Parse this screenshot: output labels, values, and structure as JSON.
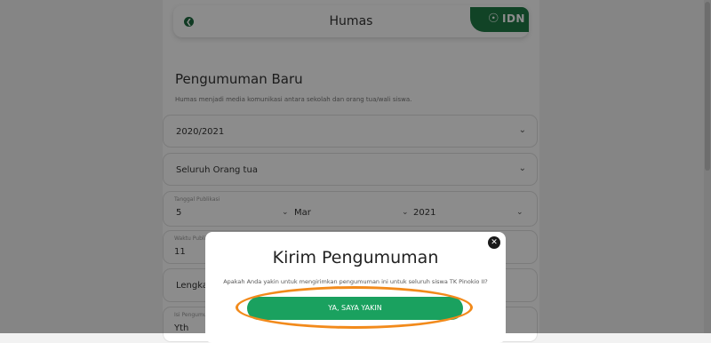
{
  "header": {
    "title": "Humas",
    "back_icon": "back-arrow-icon",
    "logo_text": "IDN"
  },
  "section": {
    "title": "Pengumuman Baru",
    "description": "Humas menjadi media komunikasi antara sekolah dan orang tua/wali siswa."
  },
  "form": {
    "year_value": "2020/2021",
    "recipient_value": "Seluruh Orang tua",
    "publish_date_label": "Tanggal Publikasi",
    "publish_day": "5",
    "publish_month": "Mar",
    "publish_year": "2021",
    "publish_time_label": "Waktu Publikasi",
    "publish_time_value": "11",
    "attachment_value": "Lengkapi",
    "content_label": "Isi Pengumuman",
    "content_value": "Yth"
  },
  "modal": {
    "title": "Kirim Pengumuman",
    "message": "Apakah Anda yakin untuk mengirimkan pengumuman ini untuk seluruh siswa TK Pinokio II?",
    "confirm_label": "YA, SAYA YAKIN",
    "close_icon": "close-icon"
  },
  "colors": {
    "brand_green": "#1f7a46",
    "button_green": "#1aa15f",
    "highlight": "#f28a1b"
  }
}
